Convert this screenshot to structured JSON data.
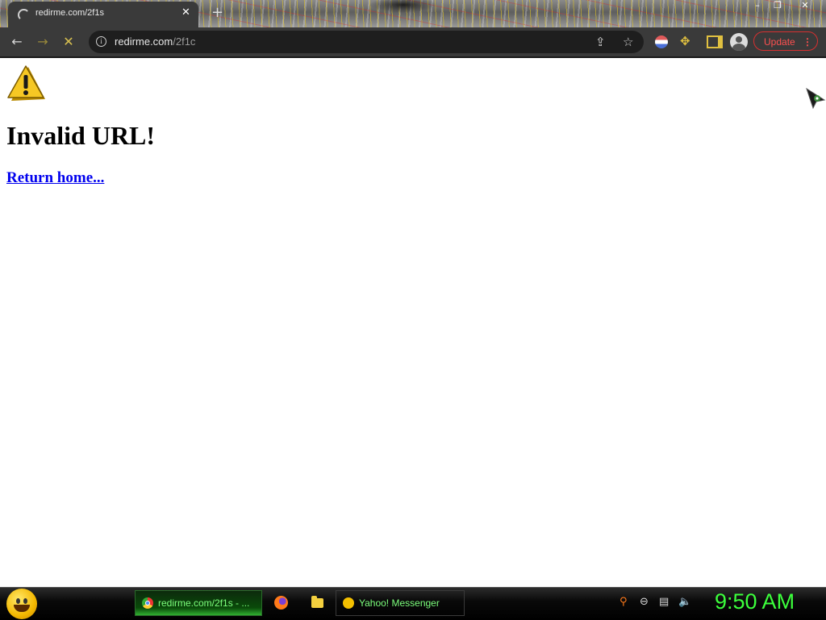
{
  "browser": {
    "tab_title": "redirme.com/2f1s",
    "url_host": "redirme.com",
    "url_path": "/2f1c",
    "update_label": "Update",
    "accent_color": "#ff5050"
  },
  "page": {
    "heading": "Invalid URL!",
    "link_text": "Return home...",
    "link_color": "#0000ee"
  },
  "taskbar": {
    "items": [
      {
        "label": "redirme.com/2f1s - ...",
        "icon": "chrome-icon"
      },
      {
        "label": "Yahoo! Messenger",
        "icon": "yahoo-messenger-icon"
      }
    ],
    "clock": "9:50 AM",
    "clock_color": "#3cff3c"
  }
}
